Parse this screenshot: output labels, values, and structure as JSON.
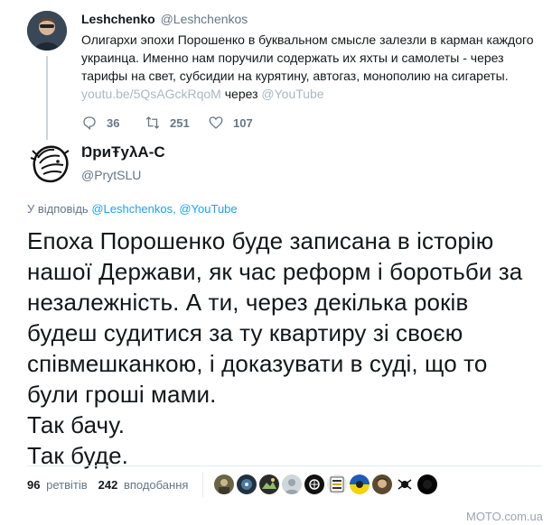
{
  "parent_tweet": {
    "display_name": "Leshchenko",
    "handle": "@Leshchenkos",
    "text": "Олигархи эпохи Порошенко в буквальном смысле залезли в карман каждого украинца. Именно нам поручили содержать их яхты и самолеты - через тарифы на свет, субсидии на курятину, автогаз, монополию на сигареты.",
    "link": "youtu.be/5QsAGckRqoM",
    "via": "через",
    "via_source": "@YouTube",
    "replies": "36",
    "retweets": "251",
    "likes": "107"
  },
  "main_tweet": {
    "display_name": "ŊриŦуλА-С",
    "handle": "@PrytSLU",
    "reply_prefix": "У відповідь",
    "reply_to_1": "@Leshchenkos,",
    "reply_to_2": "@YouTube",
    "paragraphs": [
      "Епоха Порошенко буде записана в історію нашої Держави, як час реформ і боротьби за незалежність. А ти, через декілька років будеш судитися за ту квартиру зі своєю співмешканкою, і доказувати в суді, що то були гроші мами.",
      "Так бачу.",
      "Так буде."
    ],
    "retweets_count": "96",
    "retweets_label": "ретвітів",
    "likes_count": "242",
    "likes_label": "вподобання"
  },
  "icons": {
    "reply": "reply-icon",
    "retweet": "retweet-icon",
    "like": "heart-icon"
  },
  "colors": {
    "link_blue": "#1da1f2",
    "muted": "#657786",
    "faded_link": "#aab8c2"
  },
  "watermark": "MOTO.com.ua"
}
